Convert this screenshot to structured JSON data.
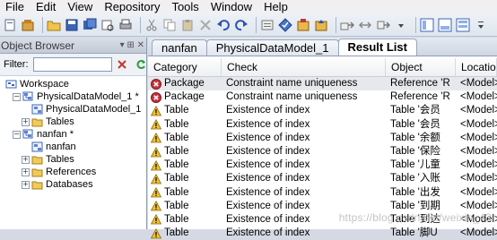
{
  "menu": {
    "items": [
      "File",
      "Edit",
      "View",
      "Repository",
      "Tools",
      "Window",
      "Help"
    ]
  },
  "toolbar": {
    "icons": [
      "new-icon",
      "open-package-icon",
      "open-folder-icon",
      "save-icon",
      "save-all-icon",
      "print-preview-icon",
      "print-icon",
      "cut-icon",
      "copy-icon",
      "paste-icon",
      "delete-icon",
      "undo-icon",
      "redo-icon",
      "properties-icon",
      "model-check-icon",
      "repository-icon",
      "update-repository-icon",
      "consolidate-icon",
      "compare-icon",
      "merge-icon",
      "dropdown-icon",
      "browser-toggle-icon",
      "output-toggle-icon",
      "result-list-toggle-icon",
      "toolbar-dropdown-icon"
    ]
  },
  "object_browser": {
    "title": "Object Browser",
    "title_controls": "▾ ⊞ ✕",
    "filter_label": "Filter:",
    "filter_value": "",
    "tree": [
      {
        "label": "Workspace",
        "level": 0,
        "expander": "",
        "icon": "workspace-icon"
      },
      {
        "label": "PhysicalDataModel_1 *",
        "level": 1,
        "expander": "−",
        "icon": "model-icon"
      },
      {
        "label": "PhysicalDataModel_1",
        "level": 2,
        "expander": "",
        "icon": "diagram-icon"
      },
      {
        "label": "Tables",
        "level": 2,
        "expander": "+",
        "icon": "folder-icon"
      },
      {
        "label": "nanfan *",
        "level": 1,
        "expander": "−",
        "icon": "model-icon"
      },
      {
        "label": "nanfan",
        "level": 2,
        "expander": "",
        "icon": "diagram-icon"
      },
      {
        "label": "Tables",
        "level": 2,
        "expander": "+",
        "icon": "folder-icon"
      },
      {
        "label": "References",
        "level": 2,
        "expander": "+",
        "icon": "folder-icon"
      },
      {
        "label": "Databases",
        "level": 2,
        "expander": "+",
        "icon": "folder-icon"
      }
    ]
  },
  "tabs": [
    {
      "label": "nanfan",
      "active": false
    },
    {
      "label": "PhysicalDataModel_1",
      "active": false
    },
    {
      "label": "Result List",
      "active": true
    }
  ],
  "result_list": {
    "columns": [
      "Category",
      "Check",
      "Object",
      "Location"
    ],
    "rows": [
      {
        "severity": "error",
        "category": "Package",
        "check": "Constraint name uniqueness",
        "object": "Reference 'R",
        "location": "<Model>"
      },
      {
        "severity": "error",
        "category": "Package",
        "check": "Constraint name uniqueness",
        "object": "Reference 'R",
        "location": "<Model>"
      },
      {
        "severity": "warning",
        "category": "Table",
        "check": "Existence of index",
        "object": "Table '会员",
        "location": "<Model>"
      },
      {
        "severity": "warning",
        "category": "Table",
        "check": "Existence of index",
        "object": "Table '会员",
        "location": "<Model>"
      },
      {
        "severity": "warning",
        "category": "Table",
        "check": "Existence of index",
        "object": "Table '余额",
        "location": "<Model>"
      },
      {
        "severity": "warning",
        "category": "Table",
        "check": "Existence of index",
        "object": "Table '保险",
        "location": "<Model>"
      },
      {
        "severity": "warning",
        "category": "Table",
        "check": "Existence of index",
        "object": "Table '儿童",
        "location": "<Model>"
      },
      {
        "severity": "warning",
        "category": "Table",
        "check": "Existence of index",
        "object": "Table '入账",
        "location": "<Model>"
      },
      {
        "severity": "warning",
        "category": "Table",
        "check": "Existence of index",
        "object": "Table '出发",
        "location": "<Model>"
      },
      {
        "severity": "warning",
        "category": "Table",
        "check": "Existence of index",
        "object": "Table '到期",
        "location": "<Model>"
      },
      {
        "severity": "warning",
        "category": "Table",
        "check": "Existence of index",
        "object": "Table '到达",
        "location": "<Model>"
      },
      {
        "severity": "warning",
        "category": "Table",
        "check": "Existence of index",
        "object": "Table '脚U",
        "location": "<Model>"
      }
    ]
  },
  "watermark": "https://blog.csdn.net/weixin_43",
  "colors": {
    "error": "#c8323c",
    "warning": "#f2c230",
    "selected_row": "#e6e8ec"
  }
}
